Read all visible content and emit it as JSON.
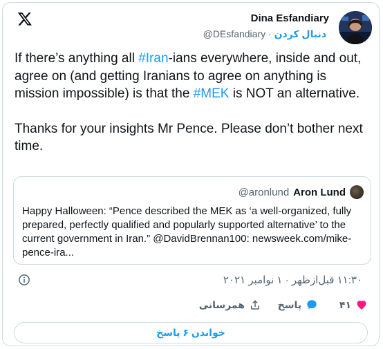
{
  "author": {
    "name": "Dina Esfandiary",
    "handle": "@DEsfandiary",
    "separator": "·",
    "follow_label": "دنبال کردن"
  },
  "tweet": {
    "p1_part1": "If there’s anything all ",
    "p1_tag1": "#Iran",
    "p1_part2": "-ians everywhere, inside and out, agree on (and getting Iranians to agree on anything is mission impossible) is that the ",
    "p1_tag2": "#MEK",
    "p1_part3": " is NOT an alternative.",
    "p2": "Thanks for your insights Mr Pence. Please don’t bother next time."
  },
  "quote": {
    "name": "Aron Lund",
    "handle": "@aronlund",
    "body": "Happy Halloween: “Pence described the MEK as ‘a well-organized, fully prepared, perfectly qualified and popularly supported alternative’ to the current government in Iran.” @DavidBrennan100: newsweek.com/mike-pence-ira..."
  },
  "timestamp": "۱۱:۳۰ قبل‌ازظهر · ۱ نوامبر ۲۰۲۱",
  "actions": {
    "likes_count": "۴۱",
    "reply_label": "پاسخ",
    "share_label": "همرسانی"
  },
  "read_replies_label": "خواندن ۶ پاسخ",
  "colors": {
    "accent": "#1d9bf0",
    "like": "#f91880",
    "muted": "#536471"
  }
}
